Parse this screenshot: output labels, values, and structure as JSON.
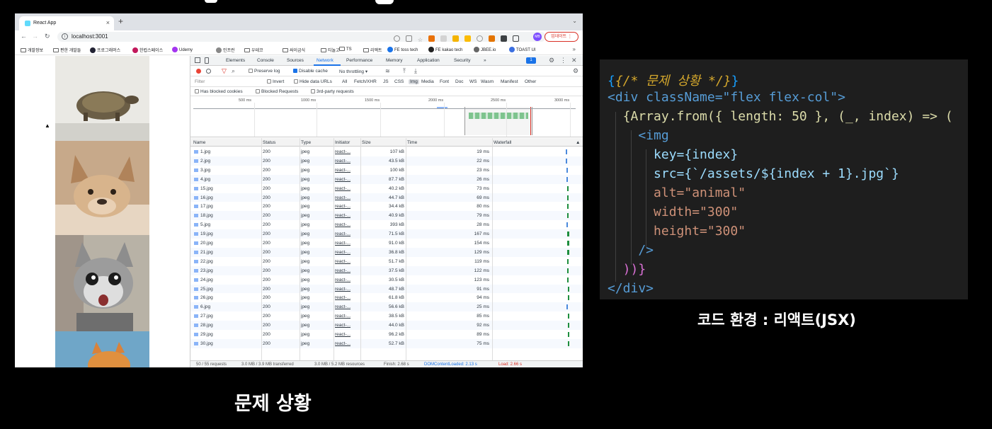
{
  "browser": {
    "tab_title": "React App",
    "tab_close": "×",
    "new_tab": "+",
    "url": "localhost:3001",
    "update_button": "업데이트 ⋮",
    "avatar_text": "MB",
    "bookmarks": [
      "개발정보",
      "편한 개발들",
      "프로그래머스",
      "한컵스페이스",
      "Udemy",
      "인프런",
      "우테코",
      "싸이금식",
      "티놀고",
      "TS",
      "리액트",
      "FE toss tech",
      "FE kakao tech",
      "JBEE.io",
      "TOAST UI"
    ],
    "bookmarks_more": "»"
  },
  "devtools": {
    "tabs": [
      "Elements",
      "Console",
      "Sources",
      "Network",
      "Performance",
      "Memory",
      "Application",
      "Security",
      "»"
    ],
    "active_tab": "Network",
    "message_badge": "1",
    "controls": {
      "preserve_log": "Preserve log",
      "disable_cache": "Disable cache",
      "throttling": "No throttling"
    },
    "filter": {
      "placeholder": "Filter",
      "invert": "Invert",
      "hide_data_urls": "Hide data URLs",
      "types": [
        "All",
        "Fetch/XHR",
        "JS",
        "CSS",
        "Img",
        "Media",
        "Font",
        "Doc",
        "WS",
        "Wasm",
        "Manifest",
        "Other"
      ],
      "active_type": "Img",
      "blocked_cookies": "Has blocked cookies",
      "blocked_requests": "Blocked Requests",
      "third_party": "3rd-party requests"
    },
    "overview_ticks": [
      "500 ms",
      "1000 ms",
      "1500 ms",
      "2000 ms",
      "2500 ms",
      "3000 ms"
    ],
    "columns": [
      "Name",
      "Status",
      "Type",
      "Initiator",
      "Size",
      "Time",
      "Waterfall"
    ],
    "rows": [
      {
        "name": "1.jpg",
        "status": "200",
        "type": "jpeg",
        "initiator": "react-...",
        "size": "107 kB",
        "time": "19 ms",
        "wf_start": 0.01,
        "wf_len": 0.02
      },
      {
        "name": "2.jpg",
        "status": "200",
        "type": "jpeg",
        "initiator": "react-...",
        "size": "43.5 kB",
        "time": "22 ms",
        "wf_start": 0.02,
        "wf_len": 0.02
      },
      {
        "name": "3.jpg",
        "status": "200",
        "type": "jpeg",
        "initiator": "react-...",
        "size": "100 kB",
        "time": "23 ms",
        "wf_start": 0.03,
        "wf_len": 0.02
      },
      {
        "name": "4.jpg",
        "status": "200",
        "type": "jpeg",
        "initiator": "react-...",
        "size": "87.7 kB",
        "time": "26 ms",
        "wf_start": 0.04,
        "wf_len": 0.02
      },
      {
        "name": "15.jpg",
        "status": "200",
        "type": "jpeg",
        "initiator": "react-...",
        "size": "40.2 kB",
        "time": "73 ms",
        "wf_start": 0.1,
        "wf_len": 0.05
      },
      {
        "name": "16.jpg",
        "status": "200",
        "type": "jpeg",
        "initiator": "react-...",
        "size": "44.7 kB",
        "time": "69 ms",
        "wf_start": 0.1,
        "wf_len": 0.05
      },
      {
        "name": "17.jpg",
        "status": "200",
        "type": "jpeg",
        "initiator": "react-...",
        "size": "34.4 kB",
        "time": "80 ms",
        "wf_start": 0.1,
        "wf_len": 0.06
      },
      {
        "name": "18.jpg",
        "status": "200",
        "type": "jpeg",
        "initiator": "react-...",
        "size": "40.9 kB",
        "time": "79 ms",
        "wf_start": 0.1,
        "wf_len": 0.06
      },
      {
        "name": "5.jpg",
        "status": "200",
        "type": "jpeg",
        "initiator": "react-...",
        "size": "393 kB",
        "time": "28 ms",
        "wf_start": 0.04,
        "wf_len": 0.02
      },
      {
        "name": "19.jpg",
        "status": "200",
        "type": "jpeg",
        "initiator": "react-...",
        "size": "71.5 kB",
        "time": "167 ms",
        "wf_start": 0.11,
        "wf_len": 0.1
      },
      {
        "name": "20.jpg",
        "status": "200",
        "type": "jpeg",
        "initiator": "react-...",
        "size": "91.0 kB",
        "time": "154 ms",
        "wf_start": 0.11,
        "wf_len": 0.09
      },
      {
        "name": "21.jpg",
        "status": "200",
        "type": "jpeg",
        "initiator": "react-...",
        "size": "36.8 kB",
        "time": "129 ms",
        "wf_start": 0.12,
        "wf_len": 0.08
      },
      {
        "name": "22.jpg",
        "status": "200",
        "type": "jpeg",
        "initiator": "react-...",
        "size": "51.7 kB",
        "time": "119 ms",
        "wf_start": 0.12,
        "wf_len": 0.07
      },
      {
        "name": "23.jpg",
        "status": "200",
        "type": "jpeg",
        "initiator": "react-...",
        "size": "37.5 kB",
        "time": "122 ms",
        "wf_start": 0.12,
        "wf_len": 0.07
      },
      {
        "name": "24.jpg",
        "status": "200",
        "type": "jpeg",
        "initiator": "react-...",
        "size": "30.5 kB",
        "time": "123 ms",
        "wf_start": 0.12,
        "wf_len": 0.07
      },
      {
        "name": "25.jpg",
        "status": "200",
        "type": "jpeg",
        "initiator": "react-...",
        "size": "48.7 kB",
        "time": "91 ms",
        "wf_start": 0.16,
        "wf_len": 0.05
      },
      {
        "name": "26.jpg",
        "status": "200",
        "type": "jpeg",
        "initiator": "react-...",
        "size": "61.8 kB",
        "time": "94 ms",
        "wf_start": 0.16,
        "wf_len": 0.05
      },
      {
        "name": "6.jpg",
        "status": "200",
        "type": "jpeg",
        "initiator": "react-...",
        "size": "56.6 kB",
        "time": "25 ms",
        "wf_start": 0.05,
        "wf_len": 0.02
      },
      {
        "name": "27.jpg",
        "status": "200",
        "type": "jpeg",
        "initiator": "react-...",
        "size": "38.5 kB",
        "time": "85 ms",
        "wf_start": 0.17,
        "wf_len": 0.05
      },
      {
        "name": "28.jpg",
        "status": "200",
        "type": "jpeg",
        "initiator": "react-...",
        "size": "44.0 kB",
        "time": "92 ms",
        "wf_start": 0.17,
        "wf_len": 0.05
      },
      {
        "name": "29.jpg",
        "status": "200",
        "type": "jpeg",
        "initiator": "react-...",
        "size": "96.2 kB",
        "time": "89 ms",
        "wf_start": 0.17,
        "wf_len": 0.05
      },
      {
        "name": "30.jpg",
        "status": "200",
        "type": "jpeg",
        "initiator": "react-...",
        "size": "52.7 kB",
        "time": "75 ms",
        "wf_start": 0.17,
        "wf_len": 0.04
      }
    ],
    "status": {
      "requests": "50 / 55 requests",
      "transferred": "3.0 MB / 3.9 MB transferred",
      "resources": "3.0 MB / 5.2 MB resources",
      "finish": "Finish: 2.68 s",
      "dcl": "DOMContentLoaded: 2.13 s",
      "load": "Load: 2.66 s"
    }
  },
  "code_lines": [
    "{/* 문제 상황 */}",
    "<div className=\"flex flex-col\">",
    "  {Array.from({ length: 50 }, (_, index) => (",
    "    <img",
    "      key={index}",
    "      src={`/assets/${index + 1}.jpg`}",
    "      alt=\"animal\"",
    "      width=\"300\"",
    "      height=\"300\"",
    "    />",
    "  ))}",
    "</div>"
  ],
  "code_caption": "코드 환경 : 리액트(JSX)",
  "subtitle": "문제 상황",
  "colors": {
    "code_bg": "#1e1e1e",
    "accent_blue": "#1a73e8",
    "record_red": "#ea4335",
    "waterfall_green": "#1e8e3e"
  }
}
